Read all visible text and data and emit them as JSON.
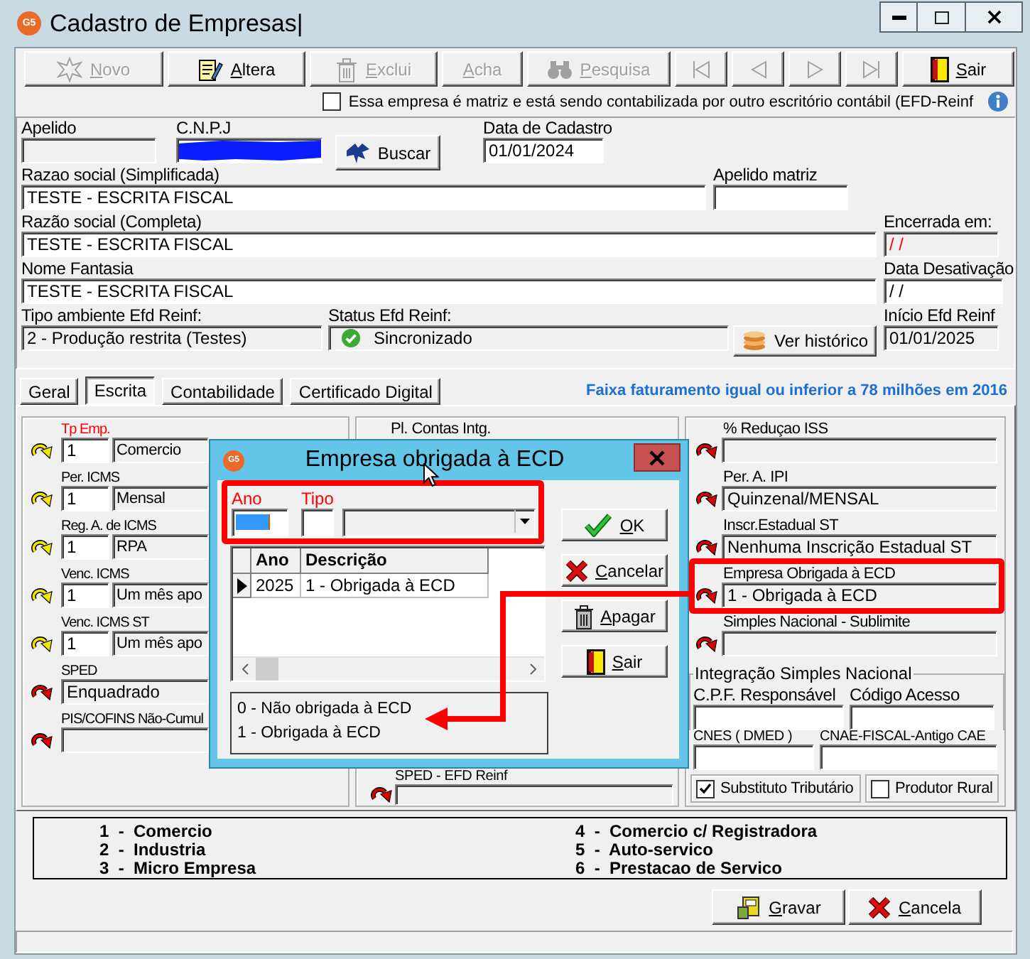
{
  "window": {
    "logo": "G5",
    "title": "Cadastro de Empresas|"
  },
  "toolbar": [
    {
      "kind": "new",
      "label": "Novo",
      "disabled": true
    },
    {
      "kind": "edit",
      "label": "Altera",
      "disabled": false
    },
    {
      "kind": "delete",
      "label": "Exclui",
      "disabled": true
    },
    {
      "kind": "find",
      "label": "Acha",
      "disabled": true
    },
    {
      "kind": "search",
      "label": "Pesquisa",
      "disabled": true
    },
    {
      "kind": "first",
      "disabled": true
    },
    {
      "kind": "prev",
      "disabled": true
    },
    {
      "kind": "next",
      "disabled": true
    },
    {
      "kind": "last",
      "disabled": true
    },
    {
      "kind": "exit",
      "label": "Sair",
      "disabled": false
    }
  ],
  "matrix_option": {
    "label": "Essa empresa é matriz e está sendo contabilizada por outro escritório contábil (EFD-Reinf",
    "checked": false
  },
  "company": {
    "apelido": {
      "label": "Apelido",
      "disabled": true
    },
    "cnpj": {
      "label": "C.N.P.J",
      "redacted": true
    },
    "search_button": {
      "label": "Buscar"
    },
    "registration_date": {
      "label": "Data de Cadastro",
      "value": "01/01/2024"
    },
    "short_name": {
      "label": "Razao social (Simplificada)",
      "value": "TESTE - ESCRITA FISCAL"
    },
    "parent_nickname": {
      "label": "Apelido matriz"
    },
    "full_name": {
      "label": "Razão social (Completa)",
      "value": "TESTE - ESCRITA FISCAL"
    },
    "closed_on": {
      "label": "Encerrada em:",
      "value": "/ /",
      "disabled": true,
      "warning": true
    },
    "trade_name": {
      "label": "Nome Fantasia",
      "value": "TESTE - ESCRITA FISCAL"
    },
    "deactivation_date": {
      "label": "Data Desativação",
      "value": "/ /"
    },
    "reinf_environment": {
      "label": "Tipo ambiente Efd Reinf:",
      "value": "2 - Produção restrita (Testes)",
      "disabled": true
    },
    "reinf_status": {
      "label": "Status Efd Reinf:",
      "value": "Sincronizado",
      "synced": true
    },
    "history_button": {
      "label": "Ver histórico"
    },
    "reinf_start": {
      "label": "Início Efd Reinf",
      "value": "01/01/2025",
      "disabled": true
    }
  },
  "tabs": [
    {
      "label": "Geral",
      "selected": false
    },
    {
      "label": "Escrita",
      "selected": true
    },
    {
      "label": "Contabilidade",
      "selected": false
    },
    {
      "label": "Certificado Digital",
      "selected": false
    }
  ],
  "notice": "Faixa faturamento igual ou inferior a 78 milhões em 2016",
  "left_panel": [
    {
      "kind": "coded",
      "label": "Tp Emp.",
      "required": true,
      "code": "1",
      "value": "Comercio"
    },
    {
      "kind": "coded",
      "label": "Per. ICMS",
      "required": false,
      "code": "1",
      "value": "Mensal"
    },
    {
      "kind": "coded",
      "label": "Reg. A. de ICMS",
      "required": false,
      "code": "1",
      "value": "RPA"
    },
    {
      "kind": "coded",
      "label": "Venc. ICMS",
      "required": false,
      "code": "1",
      "value": "Um mês apo"
    },
    {
      "kind": "coded",
      "label": "Venc. ICMS ST",
      "required": false,
      "code": "1",
      "value": "Um mês apo"
    },
    {
      "kind": "lookup",
      "label": "SPED",
      "required": false,
      "value": "Enquadrado"
    },
    {
      "kind": "lookup",
      "label": "PIS/COFINS Não-Cumul",
      "required": false
    }
  ],
  "middle_panel": {
    "top_label": "Pl. Contas Intg.",
    "bottom": {
      "label": "SPED - EFD Reinf"
    }
  },
  "right_panel": [
    {
      "label": "% Reduçao ISS"
    },
    {
      "label": "Per. A. IPI",
      "value": "Quinzenal/MENSAL"
    },
    {
      "label": "Inscr.Estadual ST",
      "value": "Nenhuma Inscrição Estadual ST"
    },
    {
      "label": "Empresa Obrigada à ECD",
      "value": "1 - Obrigada à ECD"
    },
    {
      "label": "Simples Nacional - Sublimite"
    }
  ],
  "simples_nacional": {
    "title": "Integração Simples Nacional",
    "rows": [
      {
        "fields": [
          {
            "label": "C.P.F. Responsável"
          },
          {
            "label": "Código Acesso"
          }
        ]
      },
      {
        "fields": [
          {
            "label": "CNES ( DMED )"
          },
          {
            "label": "CNAE-FISCAL-Antigo CAE"
          }
        ]
      }
    ]
  },
  "tax_options": [
    {
      "label": "Substituto Tributário",
      "checked": true
    },
    {
      "label": "Produtor Rural",
      "checked": false
    }
  ],
  "company_types": [
    "1  -  Comercio",
    "2  -  Industria",
    "3  -  Micro Empresa",
    "4  -  Comercio c/ Registradora",
    "5  -  Auto-servico",
    "6  -  Prestacao de Servico"
  ],
  "actions": [
    {
      "kind": "save",
      "label": "Gravar"
    },
    {
      "kind": "cancel",
      "label": "Cancela"
    }
  ],
  "dialog": {
    "logo": "G5",
    "title": "Empresa obrigada à ECD",
    "year": {
      "label": "Ano",
      "required": true,
      "focused": true
    },
    "type": {
      "label": "Tipo",
      "required": true
    },
    "grid": {
      "columns": [
        "Ano",
        "Descrição"
      ],
      "rows": [
        {
          "selected": true,
          "cells": [
            "2025",
            "1 - Obrigada à ECD"
          ]
        }
      ]
    },
    "legend": [
      "0 - Não obrigada à ECD",
      "1 - Obrigada à ECD"
    ],
    "buttons": [
      {
        "kind": "ok",
        "label": "OK"
      },
      {
        "kind": "cancel",
        "label": "Cancelar"
      },
      {
        "kind": "delete",
        "label": "Apagar"
      },
      {
        "kind": "exit",
        "label": "Sair"
      }
    ]
  }
}
